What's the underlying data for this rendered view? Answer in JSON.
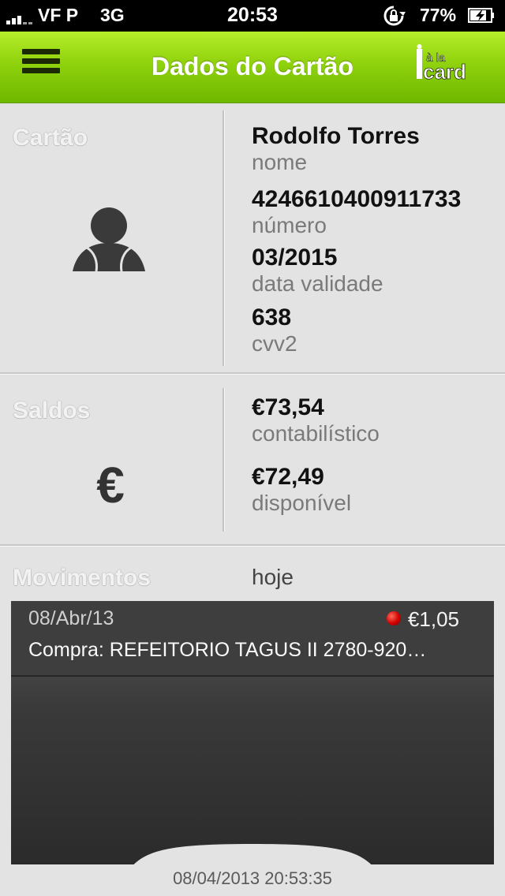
{
  "status_bar": {
    "carrier": "VF P",
    "network": "3G",
    "time": "20:53",
    "battery_percent": "77%",
    "icons": [
      "signal-icon",
      "rotation-lock-icon",
      "battery-charging-icon"
    ]
  },
  "nav": {
    "title": "Dados do Cartão",
    "menu_icon": "hamburger-menu-icon",
    "logo_text_top": "à la",
    "logo_text_bottom": "card",
    "accent_color": "#8fd20d"
  },
  "card": {
    "section_label": "Cartão",
    "icon": "person-icon",
    "fields": [
      {
        "value": "Rodolfo Torres",
        "caption": "nome"
      },
      {
        "value": "4246610400911733",
        "caption": "número"
      },
      {
        "value": "03/2015",
        "caption": "data validade"
      },
      {
        "value": "638",
        "caption": "cvv2"
      }
    ]
  },
  "balances": {
    "section_label": "Saldos",
    "icon_glyph": "€",
    "fields": [
      {
        "value": "€73,54",
        "caption": "contabilístico"
      },
      {
        "value": "€72,49",
        "caption": "disponível"
      }
    ]
  },
  "movements": {
    "section_label": "Movimentos",
    "filter": "hoje",
    "items": [
      {
        "date": "08/Abr/13",
        "amount": "€1,05",
        "description": "Compra: REFEITORIO TAGUS II 2780-920…",
        "status_color": "#d10000"
      }
    ],
    "timestamp": "08/04/2013 20:53:35"
  }
}
